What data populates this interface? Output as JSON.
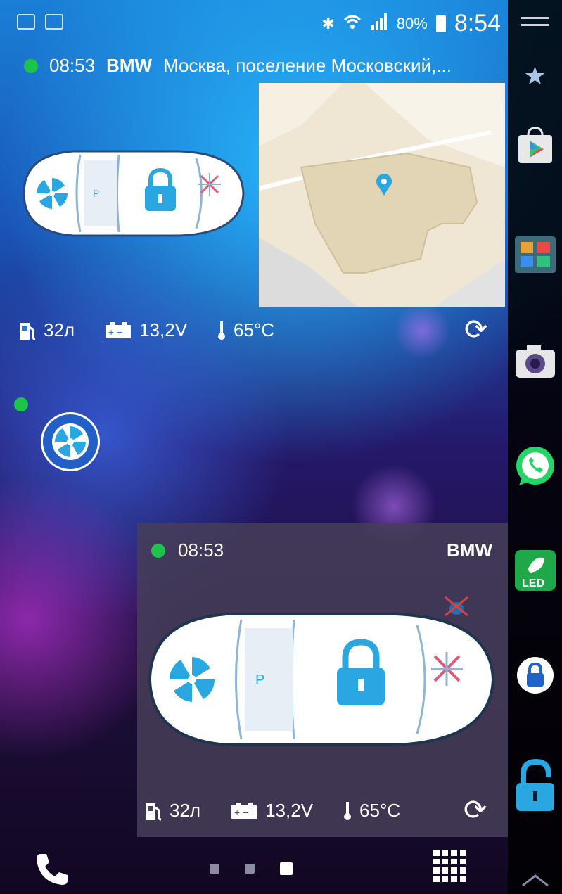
{
  "status_bar": {
    "signal_percent": "80%",
    "time": "8:54",
    "left_icons": [
      "mail-icon",
      "image-icon"
    ],
    "right_icons": [
      "bluetooth-icon",
      "wifi-icon",
      "cellular-icon",
      "battery-icon"
    ]
  },
  "top_widget": {
    "status_color": "#1ec34b",
    "time": "08:53",
    "brand": "BMW",
    "location": "Москва, поселение Московский,...",
    "map_marker": "map-pin-icon",
    "metrics": {
      "fuel": "32л",
      "battery": "13,2V",
      "temperature": "65°C"
    }
  },
  "mid_widget": {
    "status_color": "#1ec34b",
    "button_icon": "fan-icon"
  },
  "bottom_widget": {
    "status_color": "#1ec34b",
    "time": "08:53",
    "brand": "BMW",
    "metrics": {
      "fuel": "32л",
      "battery": "13,2V",
      "temperature": "65°C"
    }
  },
  "dock": {
    "items": [
      {
        "name": "menu-icon"
      },
      {
        "name": "star-icon"
      },
      {
        "name": "play-store-icon"
      },
      {
        "name": "folder-icon"
      },
      {
        "name": "camera-icon"
      },
      {
        "name": "whatsapp-icon"
      },
      {
        "name": "led-icon",
        "label": "LED"
      },
      {
        "name": "lock-app-icon"
      },
      {
        "name": "padlock-icon"
      },
      {
        "name": "chevron-up-icon"
      }
    ]
  },
  "nav": {
    "pages": 3,
    "active_page": 3
  },
  "colors": {
    "accent": "#2aa6e0",
    "online": "#1ec34b"
  }
}
